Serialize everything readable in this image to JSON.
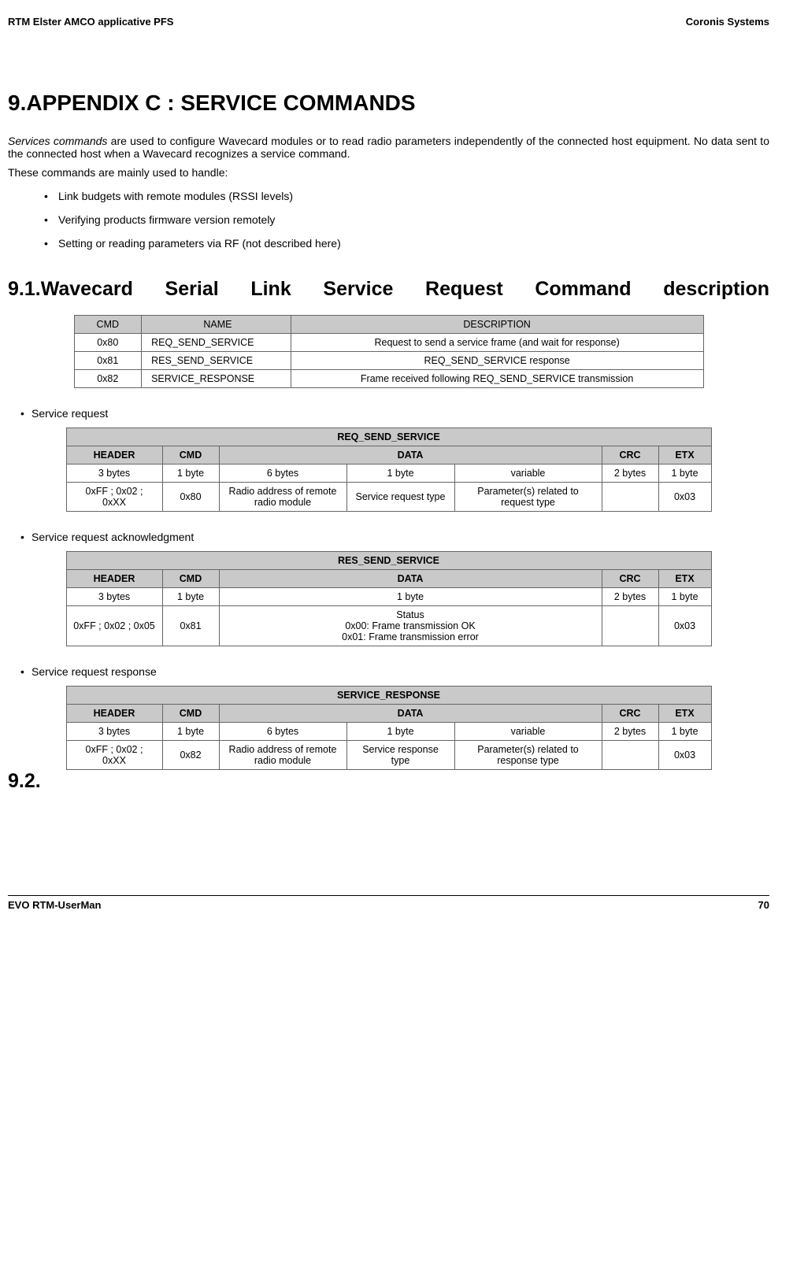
{
  "header": {
    "left": "RTM Elster AMCO applicative PFS",
    "right": "Coronis Systems"
  },
  "h1": "9.APPENDIX C : SERVICE COMMANDS",
  "intro1": "Services commands are used to configure Wavecard modules or to read radio parameters independently of the connected host equipment. No data sent to the connected host when a Wavecard recognizes a service command.",
  "intro2": "These commands are mainly used to handle:",
  "bullets": {
    "b1": "Link budgets with remote modules (RSSI levels)",
    "b2": "Verifying products firmware version remotely",
    "b3": "Setting or reading parameters via RF (not described here)"
  },
  "h2": "9.1.Wavecard Serial Link Service Request Command description",
  "table1": {
    "h": {
      "cmd": "CMD",
      "name": "NAME",
      "desc": "DESCRIPTION"
    },
    "r1": {
      "cmd": "0x80",
      "name": "REQ_SEND_SERVICE",
      "desc": "Request to send a service frame (and wait for response)"
    },
    "r2": {
      "cmd": "0x81",
      "name": "RES_SEND_SERVICE",
      "desc": "REQ_SEND_SERVICE response"
    },
    "r3": {
      "cmd": "0x82",
      "name": "SERVICE_RESPONSE",
      "desc": "Frame received following REQ_SEND_SERVICE transmission"
    }
  },
  "sub1": "Service request",
  "table2": {
    "title": "REQ_SEND_SERVICE",
    "h": {
      "header": "HEADER",
      "cmd": "CMD",
      "data": "DATA",
      "crc": "CRC",
      "etx": "ETX"
    },
    "r1": {
      "c1": "3 bytes",
      "c2": "1 byte",
      "c3": "6 bytes",
      "c4": "1 byte",
      "c5": "variable",
      "c6": "2 bytes",
      "c7": "1 byte"
    },
    "r2": {
      "c1": "0xFF ; 0x02 ; 0xXX",
      "c2": "0x80",
      "c3": "Radio address of remote  radio module",
      "c4": "Service request type",
      "c5": "Parameter(s) related to request type",
      "c6": "",
      "c7": "0x03"
    }
  },
  "sub2": "Service request acknowledgment",
  "table3": {
    "title": "RES_SEND_SERVICE",
    "h": {
      "header": "HEADER",
      "cmd": "CMD",
      "data": "DATA",
      "crc": "CRC",
      "etx": "ETX"
    },
    "r1": {
      "c1": "3 bytes",
      "c2": "1 byte",
      "c3": "1 byte",
      "c4": "2 bytes",
      "c5": "1 byte"
    },
    "r2": {
      "c1": "0xFF ; 0x02 ; 0x05",
      "c2": "0x81",
      "c3": "Status\n0x00: Frame transmission OK\n0x01: Frame transmission error",
      "c4": "",
      "c5": "0x03"
    }
  },
  "sub3": "Service request response",
  "table4": {
    "title": "SERVICE_RESPONSE",
    "h": {
      "header": "HEADER",
      "cmd": "CMD",
      "data": "DATA",
      "crc": "CRC",
      "etx": "ETX"
    },
    "r1": {
      "c1": "3 bytes",
      "c2": "1 byte",
      "c3": "6 bytes",
      "c4": "1 byte",
      "c5": "variable",
      "c6": "2 bytes",
      "c7": "1 byte"
    },
    "r2": {
      "c1": "0xFF ; 0x02 ; 0xXX",
      "c2": "0x82",
      "c3": "Radio address of remote  radio module",
      "c4": "Service response type",
      "c5": "Parameter(s) related to response type",
      "c6": "",
      "c7": "0x03"
    }
  },
  "sec92": "9.2.",
  "footer": {
    "left": "EVO RTM-UserMan",
    "right": "70"
  }
}
